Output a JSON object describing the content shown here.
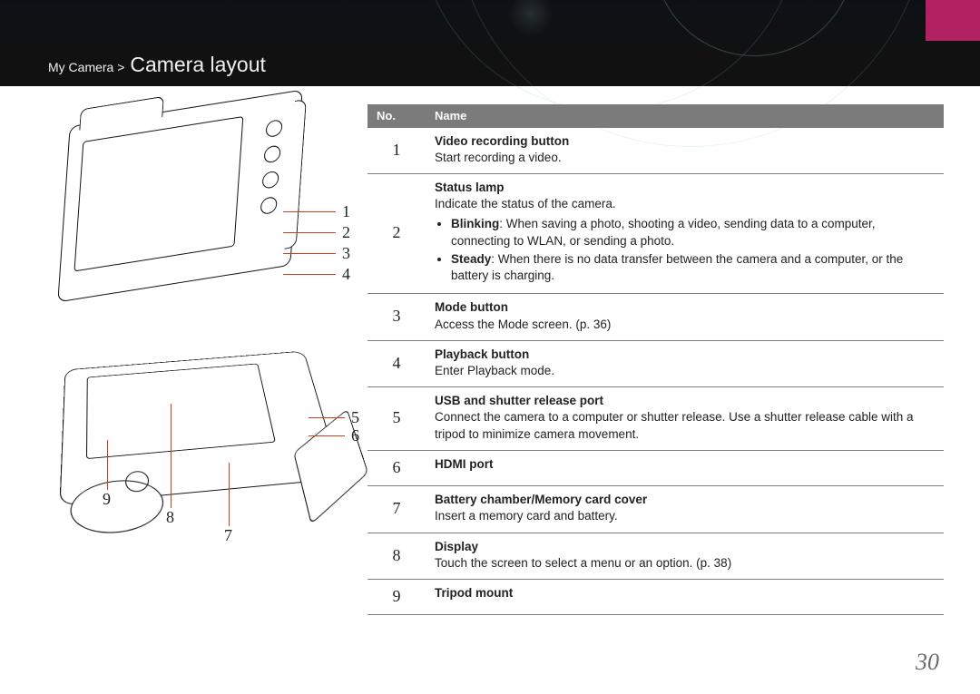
{
  "breadcrumb": {
    "section": "My Camera",
    "sep": ">",
    "title": "Camera layout"
  },
  "page_number": "30",
  "table": {
    "headers": {
      "no": "No.",
      "name": "Name"
    },
    "rows": [
      {
        "no": "1",
        "title": "Video recording button",
        "desc": "Start recording a video."
      },
      {
        "no": "2",
        "title": "Status lamp",
        "desc": "Indicate the status of the camera.",
        "bullets": [
          {
            "lead": "Blinking",
            "text": ": When saving a photo, shooting a video, sending data to a computer, connecting to WLAN, or sending a photo."
          },
          {
            "lead": "Steady",
            "text": ": When there is no data transfer between the camera and a computer, or the battery is charging."
          }
        ]
      },
      {
        "no": "3",
        "title": "Mode button",
        "desc": "Access the Mode screen. (p. 36)"
      },
      {
        "no": "4",
        "title": "Playback button",
        "desc": "Enter Playback mode."
      },
      {
        "no": "5",
        "title": "USB and shutter release port",
        "desc": "Connect the camera to a computer or shutter release. Use a shutter release cable with a tripod to minimize camera movement."
      },
      {
        "no": "6",
        "title": "HDMI port",
        "desc": ""
      },
      {
        "no": "7",
        "title": "Battery chamber/Memory card cover",
        "desc": "Insert a memory card and battery."
      },
      {
        "no": "8",
        "title": "Display",
        "desc": "Touch the screen to select a menu or an option. (p. 38)"
      },
      {
        "no": "9",
        "title": "Tripod mount",
        "desc": ""
      }
    ]
  },
  "diagram": {
    "top_labels": [
      "1",
      "2",
      "3",
      "4"
    ],
    "bottom_right": [
      "5",
      "6"
    ],
    "bottom_bottom": [
      "9",
      "8",
      "7"
    ]
  }
}
